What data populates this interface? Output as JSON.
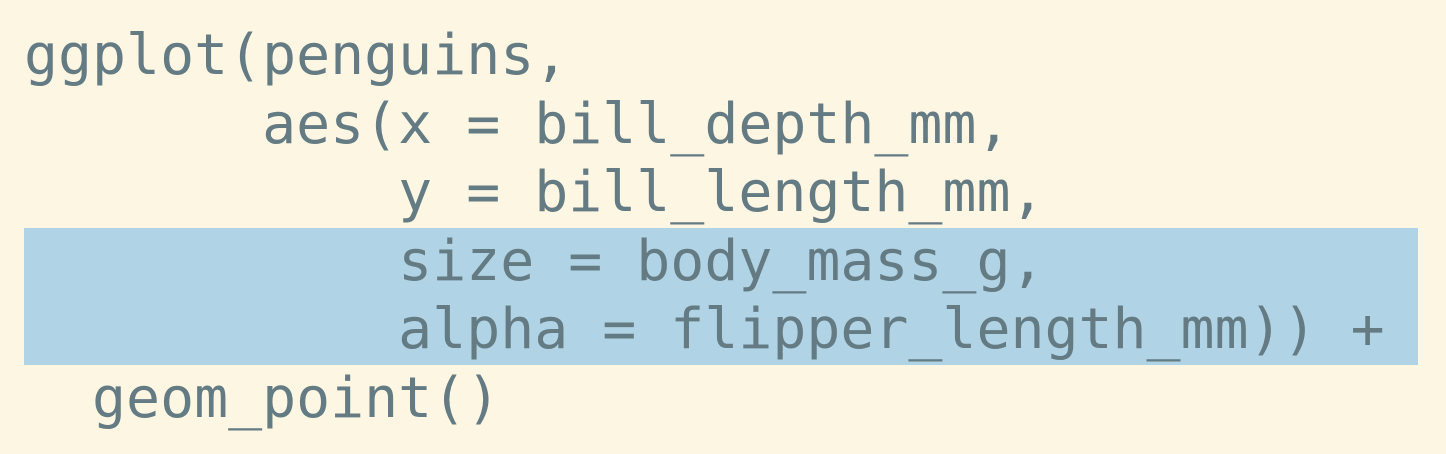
{
  "code": {
    "lines": [
      {
        "text": "ggplot(penguins,",
        "highlighted": false
      },
      {
        "text": "       aes(x = bill_depth_mm,",
        "highlighted": false
      },
      {
        "text": "           y = bill_length_mm,",
        "highlighted": false
      },
      {
        "text": "           size = body_mass_g,",
        "highlighted": true
      },
      {
        "text": "           alpha = flipper_length_mm)) +",
        "highlighted": true
      },
      {
        "text": "  geom_point()",
        "highlighted": false
      }
    ]
  },
  "colors": {
    "background": "#fdf6e3",
    "text": "#657b83",
    "highlight": "#b0d3e6"
  }
}
